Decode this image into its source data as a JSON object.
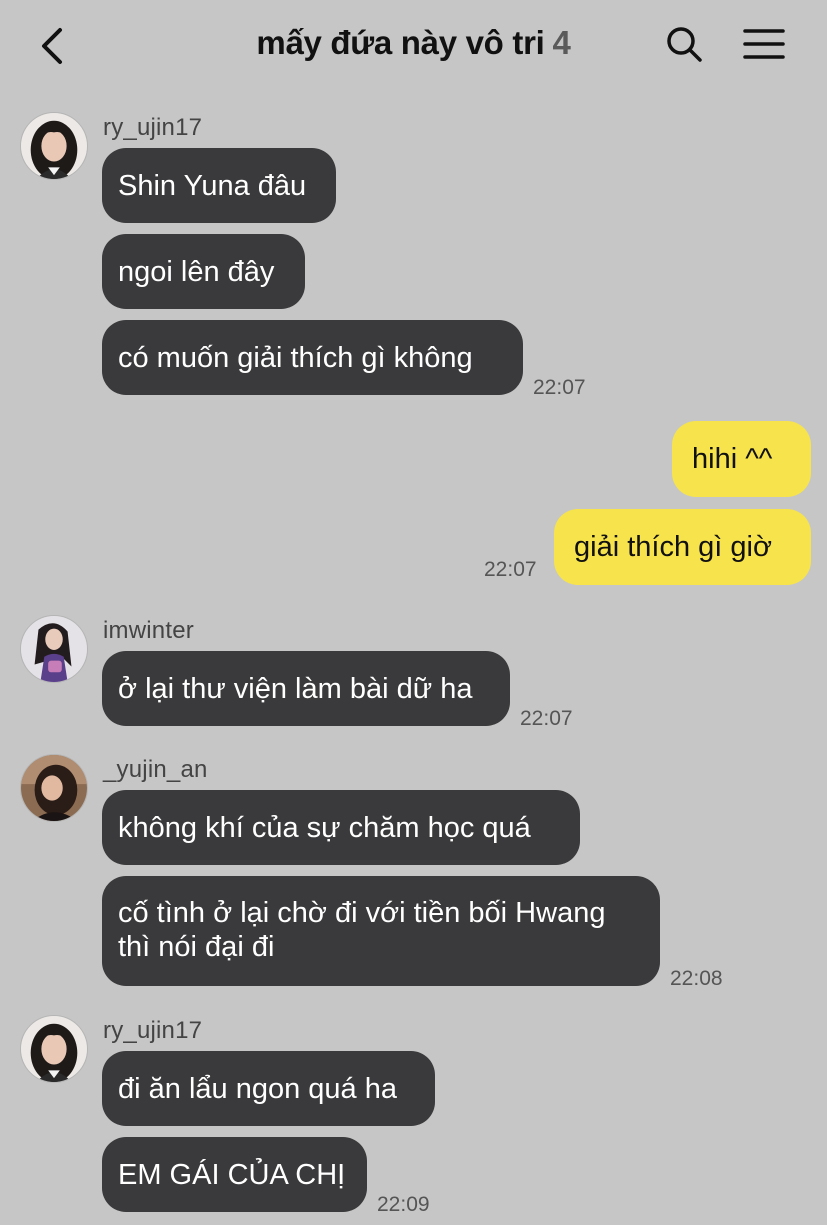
{
  "header": {
    "title": "mấy đứa này vô tri",
    "member_count": "4"
  },
  "messages": {
    "g1": {
      "sender": "ry_ujin17",
      "m1": "Shin Yuna đâu",
      "m2": "ngoi lên đây",
      "m3": "có muốn giải thích gì không",
      "time": "22:07"
    },
    "g2": {
      "m1": "hihi ^^",
      "m2": "giải thích gì giờ",
      "time": "22:07"
    },
    "g3": {
      "sender": "imwinter",
      "m1": "ở lại thư viện làm bài dữ ha",
      "time": "22:07"
    },
    "g4": {
      "sender": "_yujin_an",
      "m1": "không khí của sự chăm học quá",
      "m2_line1": "cố tình ở lại chờ đi với tiền bối Hwang",
      "m2_line2": "thì nói đại đi",
      "time": "22:08"
    },
    "g5": {
      "sender": "ry_ujin17",
      "m1": "đi ăn lẩu ngon quá ha",
      "m2": "EM GÁI CỦA CHỊ",
      "time": "22:09"
    }
  },
  "colors": {
    "background": "#c6c6c6",
    "incoming_bubble": "#3a3a3c",
    "outgoing_bubble": "#f7e34c"
  },
  "icons": [
    "back-arrow-icon",
    "search-icon",
    "hamburger-menu-icon"
  ]
}
